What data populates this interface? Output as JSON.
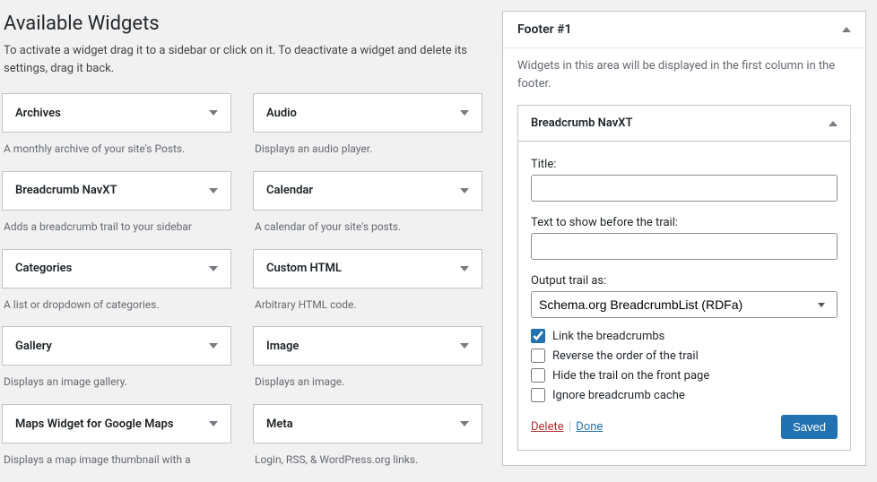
{
  "available": {
    "heading": "Available Widgets",
    "description": "To activate a widget drag it to a sidebar or click on it. To deactivate a widget and delete its settings, drag it back.",
    "widgets": [
      {
        "title": "Archives",
        "desc": "A monthly archive of your site's Posts."
      },
      {
        "title": "Audio",
        "desc": "Displays an audio player."
      },
      {
        "title": "Breadcrumb NavXT",
        "desc": "Adds a breadcrumb trail to your sidebar"
      },
      {
        "title": "Calendar",
        "desc": "A calendar of your site's posts."
      },
      {
        "title": "Categories",
        "desc": "A list or dropdown of categories."
      },
      {
        "title": "Custom HTML",
        "desc": "Arbitrary HTML code."
      },
      {
        "title": "Gallery",
        "desc": "Displays an image gallery."
      },
      {
        "title": "Image",
        "desc": "Displays an image."
      },
      {
        "title": "Maps Widget for Google Maps",
        "desc": "Displays a map image thumbnail with a"
      },
      {
        "title": "Meta",
        "desc": "Login, RSS, & WordPress.org links."
      }
    ]
  },
  "sidebar": {
    "title": "Footer #1",
    "desc": "Widgets in this area will be displayed in the first column in the footer.",
    "widget": {
      "title": "Breadcrumb NavXT",
      "fields": {
        "title_label": "Title:",
        "title_value": "",
        "pretext_label": "Text to show before the trail:",
        "pretext_value": "",
        "output_label": "Output trail as:",
        "output_value": "Schema.org BreadcrumbList (RDFa)",
        "chk_link": "Link the breadcrumbs",
        "chk_reverse": "Reverse the order of the trail",
        "chk_hidefront": "Hide the trail on the front page",
        "chk_ignorecache": "Ignore breadcrumb cache"
      },
      "controls": {
        "delete": "Delete",
        "done": "Done",
        "saved": "Saved"
      }
    }
  }
}
